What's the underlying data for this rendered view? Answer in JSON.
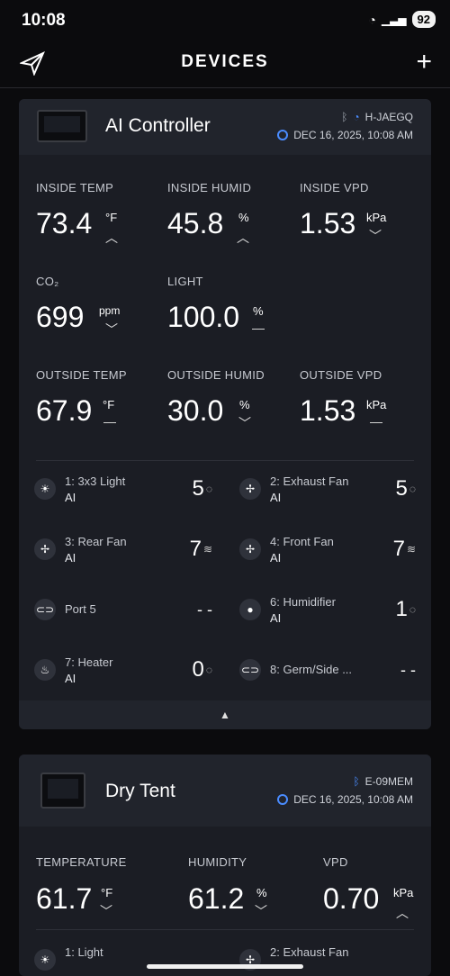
{
  "status": {
    "time": "10:08",
    "battery": "92"
  },
  "nav": {
    "title": "DEVICES",
    "add": "+"
  },
  "controller": {
    "name": "AI Controller",
    "network": "H-JAEGQ",
    "timestamp": "DEC 16, 2025, 10:08 AM",
    "sensors": [
      {
        "label": "INSIDE TEMP",
        "value": "73.4",
        "unit": "°F",
        "trend": "up"
      },
      {
        "label": "INSIDE HUMID",
        "value": "45.8",
        "unit": "%",
        "trend": "up"
      },
      {
        "label": "INSIDE VPD",
        "value": "1.53",
        "unit": "kPa",
        "trend": "down"
      },
      {
        "label": "CO₂",
        "value": "699",
        "unit": "ppm",
        "trend": "down"
      },
      {
        "label": "LIGHT",
        "value": "100.0",
        "unit": "%",
        "trend": "flat"
      },
      {
        "label": "OUTSIDE TEMP",
        "value": "67.9",
        "unit": "°F",
        "trend": "flat"
      },
      {
        "label": "OUTSIDE HUMID",
        "value": "30.0",
        "unit": "%",
        "trend": "down"
      },
      {
        "label": "OUTSIDE VPD",
        "value": "1.53",
        "unit": "kPa",
        "trend": "flat"
      }
    ],
    "ports": [
      {
        "name": "1: 3x3 Light",
        "mode": "AI",
        "level": "5",
        "icon": "light-icon"
      },
      {
        "name": "2: Exhaust Fan",
        "mode": "AI",
        "level": "5",
        "icon": "fan-icon"
      },
      {
        "name": "3: Rear Fan",
        "mode": "AI",
        "level": "7",
        "icon": "fan-icon"
      },
      {
        "name": "4: Front Fan",
        "mode": "AI",
        "level": "7",
        "icon": "fan-icon"
      },
      {
        "name": "Port 5",
        "mode": "",
        "level": "- -",
        "icon": "link-icon"
      },
      {
        "name": "6: Humidifier",
        "mode": "AI",
        "level": "1",
        "icon": "droplet-icon"
      },
      {
        "name": "7: Heater",
        "mode": "AI",
        "level": "0",
        "icon": "flame-icon"
      },
      {
        "name": "8: Germ/Side ...",
        "mode": "",
        "level": "- -",
        "icon": "link-icon"
      }
    ]
  },
  "tent": {
    "name": "Dry Tent",
    "network": "E-09MEM",
    "timestamp": "DEC 16, 2025, 10:08 AM",
    "sensors": [
      {
        "label": "TEMPERATURE",
        "value": "61.7",
        "unit": "°F",
        "trend": "down"
      },
      {
        "label": "HUMIDITY",
        "value": "61.2",
        "unit": "%",
        "trend": "down"
      },
      {
        "label": "VPD",
        "value": "0.70",
        "unit": "kPa",
        "trend": "up"
      }
    ],
    "ports": [
      {
        "name": "1: Light"
      },
      {
        "name": "2: Exhaust Fan"
      }
    ]
  },
  "colors": {
    "accent": "#4a8cff",
    "card": "#1b1d24",
    "header": "#21242c"
  }
}
